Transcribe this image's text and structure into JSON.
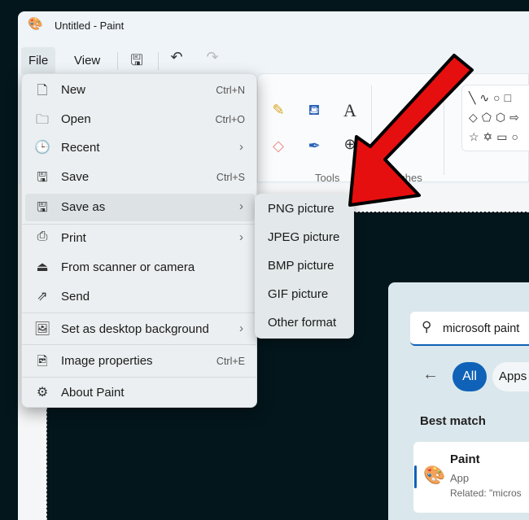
{
  "window": {
    "title": "Untitled - Paint"
  },
  "menubar": {
    "file": "File",
    "view": "View"
  },
  "ribbon": {
    "tools_label": "Tools",
    "brushes_label": "Brushes"
  },
  "file_menu": {
    "items": [
      {
        "label": "New",
        "shortcut": "Ctrl+N",
        "icon": "new-file-icon"
      },
      {
        "label": "Open",
        "shortcut": "Ctrl+O",
        "icon": "folder-icon"
      },
      {
        "label": "Recent",
        "icon": "clock-icon"
      },
      {
        "label": "Save",
        "shortcut": "Ctrl+S",
        "icon": "save-icon"
      },
      {
        "label": "Save as",
        "icon": "save-as-icon"
      },
      {
        "label": "Print",
        "icon": "printer-icon"
      },
      {
        "label": "From scanner or camera",
        "icon": "scanner-icon"
      },
      {
        "label": "Send",
        "icon": "share-icon"
      },
      {
        "label": "Set as desktop background",
        "icon": "desktop-icon"
      },
      {
        "label": "Image properties",
        "shortcut": "Ctrl+E",
        "icon": "image-properties-icon"
      },
      {
        "label": "About Paint",
        "icon": "gear-icon"
      }
    ]
  },
  "save_as_submenu": [
    "PNG picture",
    "JPEG picture",
    "BMP picture",
    "GIF picture",
    "Other format"
  ],
  "search_panel": {
    "query": "microsoft paint",
    "filters": [
      "All",
      "Apps"
    ],
    "best_match_label": "Best match",
    "result": {
      "name": "Paint",
      "type": "App",
      "related": "Related: \"micros"
    }
  },
  "colors": {
    "accent": "#0f62b8",
    "arrow": "#e60f0f"
  }
}
